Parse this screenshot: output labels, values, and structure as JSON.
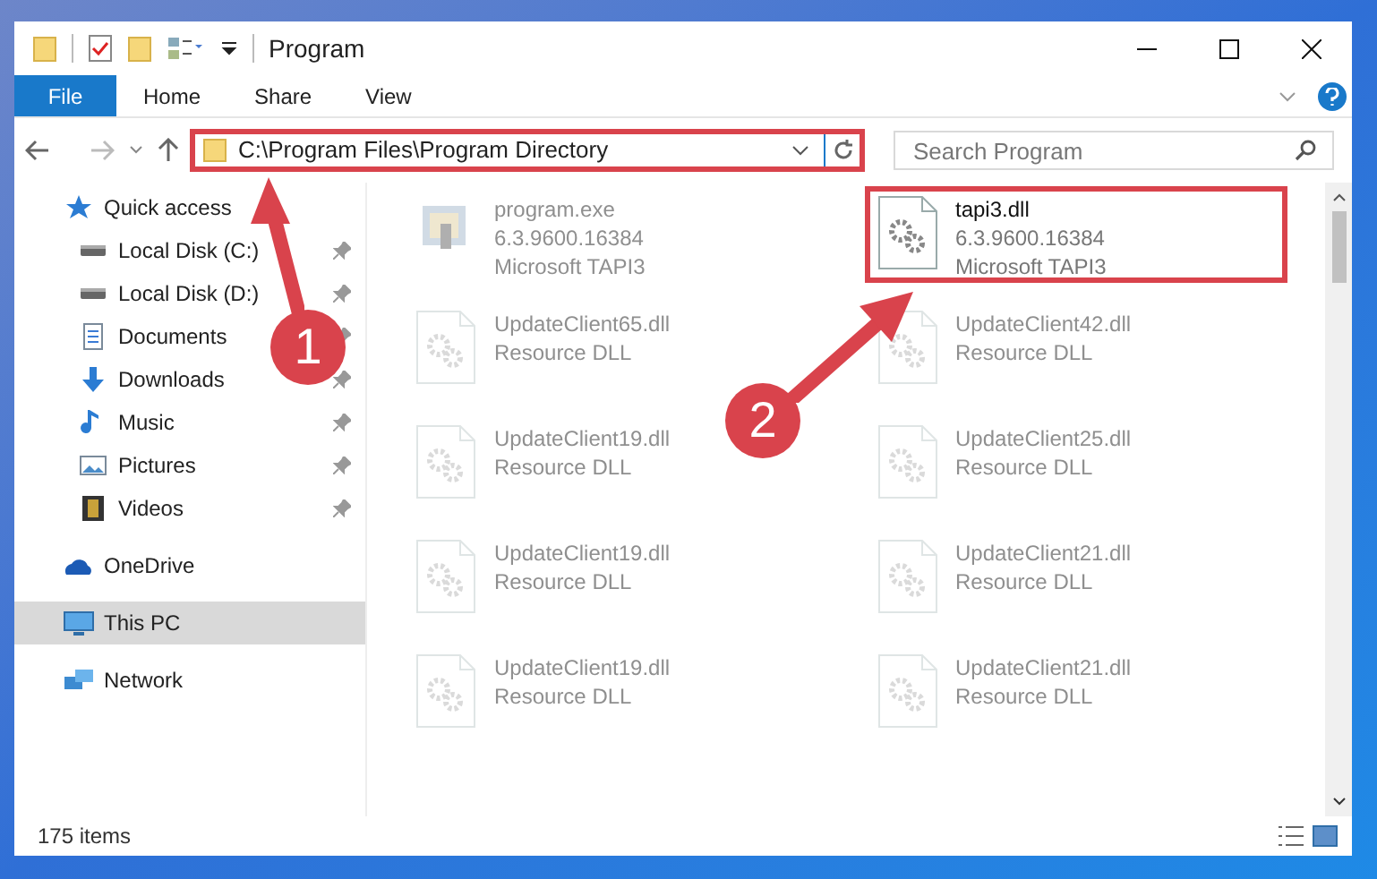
{
  "window": {
    "title": "Program"
  },
  "ribbon_tabs": [
    {
      "label": "File",
      "selected": true
    },
    {
      "label": "Home",
      "selected": false
    },
    {
      "label": "Share",
      "selected": false
    },
    {
      "label": "View",
      "selected": false
    }
  ],
  "address": {
    "value": "C:\\Program Files\\Program Directory",
    "highlighted": true
  },
  "search": {
    "placeholder": "Search Program"
  },
  "sidebar": {
    "items": [
      {
        "label": "Quick access",
        "selected": false,
        "children": [
          {
            "label": "Local Disk (C:)",
            "pinned": true
          },
          {
            "label": "Local Disk (D:)",
            "pinned": true
          },
          {
            "label": "Documents",
            "pinned": true
          },
          {
            "label": "Downloads",
            "pinned": true
          },
          {
            "label": "Music",
            "pinned": true
          },
          {
            "label": "Pictures",
            "pinned": true
          },
          {
            "label": "Videos",
            "pinned": true
          }
        ]
      },
      {
        "label": "OneDrive",
        "selected": false
      },
      {
        "label": "This PC",
        "selected": true
      },
      {
        "label": "Network",
        "selected": false
      }
    ]
  },
  "files": [
    {
      "kind": "exe",
      "name": "program.exe",
      "lines": [
        "6.3.9600.16384",
        "Microsoft TAPI3"
      ],
      "faded": true,
      "highlighted": false
    },
    {
      "kind": "dll",
      "name": "tapi3.dll",
      "lines": [
        "6.3.9600.16384",
        "Microsoft TAPI3"
      ],
      "faded": false,
      "highlighted": true
    },
    {
      "kind": "dll",
      "name": "UpdateClient65.dll",
      "lines": [
        "Resource DLL"
      ],
      "faded": true,
      "highlighted": false
    },
    {
      "kind": "dll",
      "name": "UpdateClient42.dll",
      "lines": [
        "Resource DLL"
      ],
      "faded": true,
      "highlighted": false
    },
    {
      "kind": "dll",
      "name": "UpdateClient19.dll",
      "lines": [
        "Resource DLL"
      ],
      "faded": true,
      "highlighted": false
    },
    {
      "kind": "dll",
      "name": "UpdateClient25.dll",
      "lines": [
        "Resource DLL"
      ],
      "faded": true,
      "highlighted": false
    },
    {
      "kind": "dll",
      "name": "UpdateClient19.dll",
      "lines": [
        "Resource DLL"
      ],
      "faded": true,
      "highlighted": false
    },
    {
      "kind": "dll",
      "name": "UpdateClient21.dll",
      "lines": [
        "Resource DLL"
      ],
      "faded": true,
      "highlighted": false
    },
    {
      "kind": "dll",
      "name": "UpdateClient19.dll",
      "lines": [
        "Resource DLL"
      ],
      "faded": true,
      "highlighted": false
    },
    {
      "kind": "dll",
      "name": "UpdateClient21.dll",
      "lines": [
        "Resource DLL"
      ],
      "faded": true,
      "highlighted": false
    }
  ],
  "status_bar": {
    "text": "175 items"
  },
  "annotations": [
    {
      "label": "1"
    },
    {
      "label": "2"
    }
  ]
}
